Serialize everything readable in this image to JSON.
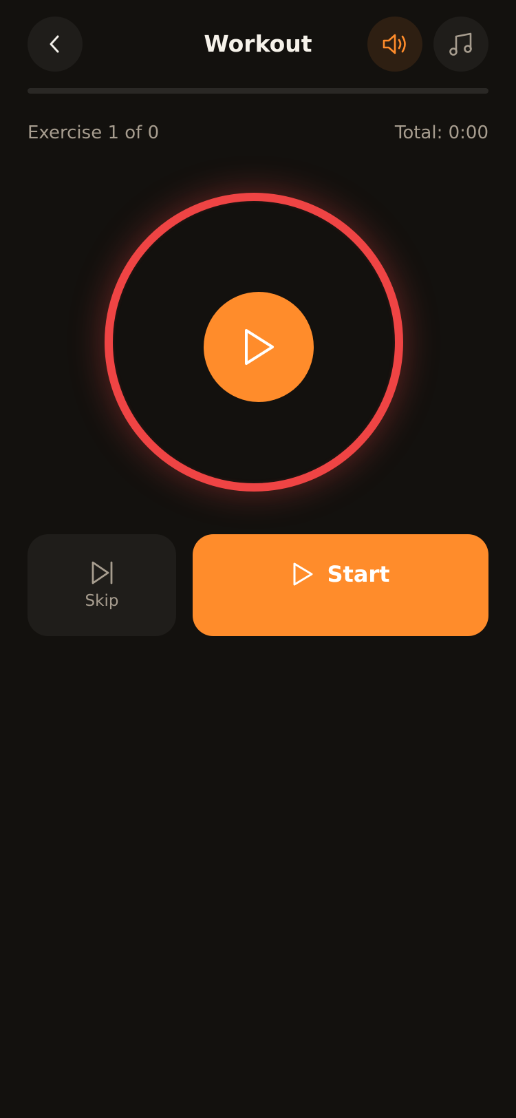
{
  "header": {
    "title": "Workout",
    "back_icon": "chevron-left-icon",
    "sound_icon": "speaker-icon",
    "music_icon": "music-note-icon"
  },
  "progress": {
    "fraction": 0
  },
  "session": {
    "exercise_counter": "Exercise 1 of 0",
    "total_time": "Total: 0:00"
  },
  "timer": {
    "ring_color": "#ef4444",
    "play_icon": "play-icon"
  },
  "controls": {
    "skip_label": "Skip",
    "skip_icon": "skip-forward-icon",
    "start_label": "Start",
    "start_icon": "play-icon"
  },
  "colors": {
    "background": "#13110e",
    "accent": "#ff8c2b",
    "ring": "#ef4444",
    "muted_text": "#a79d8f"
  }
}
